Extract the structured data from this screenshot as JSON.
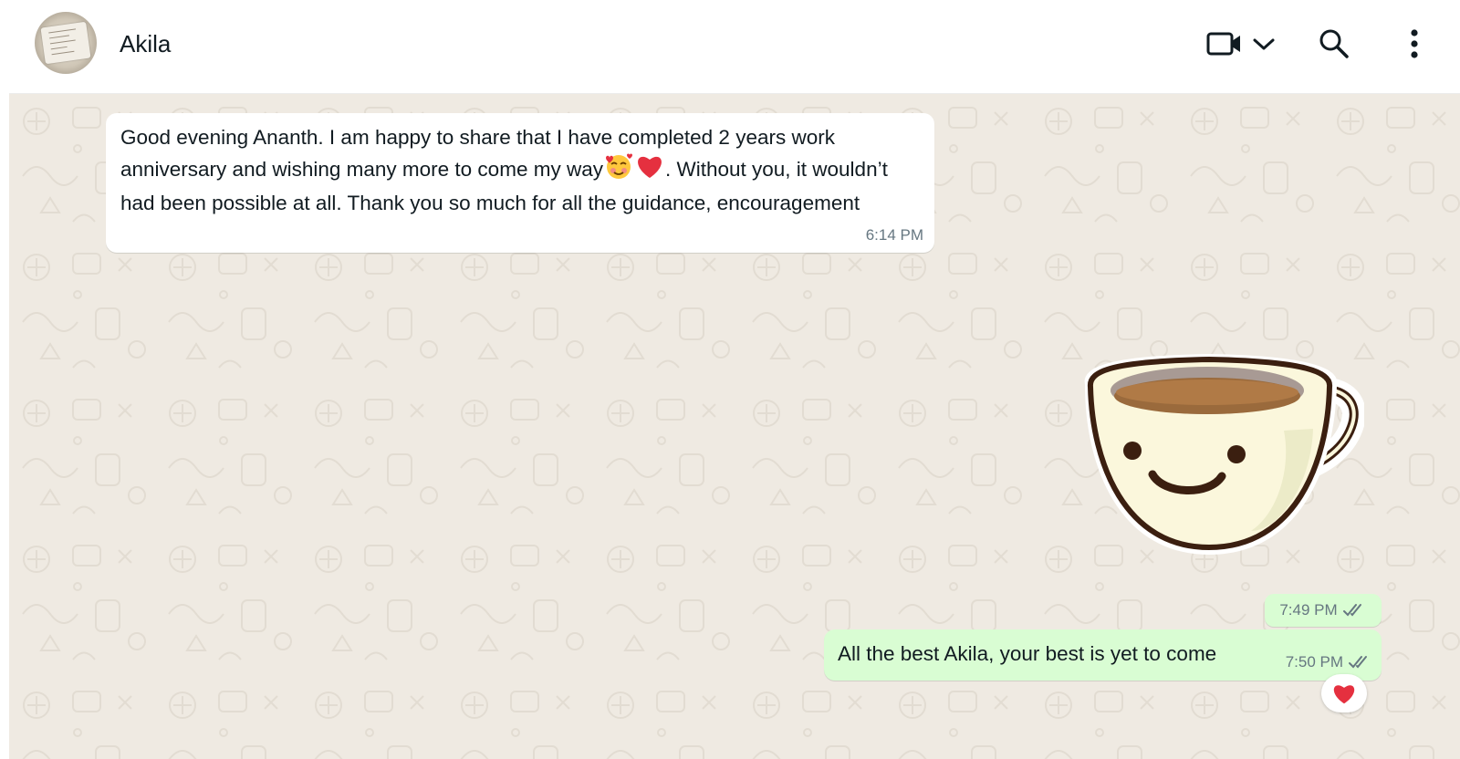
{
  "header": {
    "contact_name": "Akila",
    "icons": {
      "video": "video-camera-icon",
      "dropdown": "chevron-down-icon",
      "search": "search-icon",
      "menu": "kebab-menu-icon"
    }
  },
  "messages": [
    {
      "direction": "incoming",
      "parts": [
        "Good evening Ananth. I am happy to share that I have completed 2 years work anniversary and wishing many more to come my way",
        ". Without you, it wouldn’t had been possible at all. Thank you so much for all the guidance, encouragement"
      ],
      "emojis": [
        "smiling-face-with-hearts",
        "red-heart"
      ],
      "time": "6:14 PM"
    },
    {
      "direction": "outgoing",
      "type": "sticker",
      "sticker": "smiling-coffee-cup",
      "time": "7:49 PM",
      "status": "read"
    },
    {
      "direction": "outgoing",
      "text": "All the best Akila, your best is yet to come",
      "time": "7:50 PM",
      "status": "read",
      "reaction": "red-heart"
    }
  ],
  "colors": {
    "chat_bg": "#efeae2",
    "incoming_bubble": "#ffffff",
    "outgoing_bubble": "#d9fdd3",
    "read_ticks": "#667781",
    "heart": "#e5303f"
  }
}
